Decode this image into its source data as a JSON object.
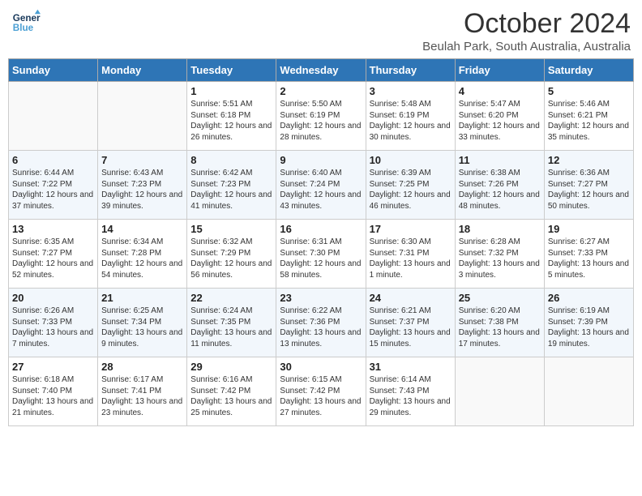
{
  "header": {
    "logo_line1": "General",
    "logo_line2": "Blue",
    "month": "October 2024",
    "location": "Beulah Park, South Australia, Australia"
  },
  "weekdays": [
    "Sunday",
    "Monday",
    "Tuesday",
    "Wednesday",
    "Thursday",
    "Friday",
    "Saturday"
  ],
  "weeks": [
    [
      {
        "day": "",
        "content": ""
      },
      {
        "day": "",
        "content": ""
      },
      {
        "day": "1",
        "content": "Sunrise: 5:51 AM\nSunset: 6:18 PM\nDaylight: 12 hours\nand 26 minutes."
      },
      {
        "day": "2",
        "content": "Sunrise: 5:50 AM\nSunset: 6:19 PM\nDaylight: 12 hours\nand 28 minutes."
      },
      {
        "day": "3",
        "content": "Sunrise: 5:48 AM\nSunset: 6:19 PM\nDaylight: 12 hours\nand 30 minutes."
      },
      {
        "day": "4",
        "content": "Sunrise: 5:47 AM\nSunset: 6:20 PM\nDaylight: 12 hours\nand 33 minutes."
      },
      {
        "day": "5",
        "content": "Sunrise: 5:46 AM\nSunset: 6:21 PM\nDaylight: 12 hours\nand 35 minutes."
      }
    ],
    [
      {
        "day": "6",
        "content": "Sunrise: 6:44 AM\nSunset: 7:22 PM\nDaylight: 12 hours\nand 37 minutes."
      },
      {
        "day": "7",
        "content": "Sunrise: 6:43 AM\nSunset: 7:23 PM\nDaylight: 12 hours\nand 39 minutes."
      },
      {
        "day": "8",
        "content": "Sunrise: 6:42 AM\nSunset: 7:23 PM\nDaylight: 12 hours\nand 41 minutes."
      },
      {
        "day": "9",
        "content": "Sunrise: 6:40 AM\nSunset: 7:24 PM\nDaylight: 12 hours\nand 43 minutes."
      },
      {
        "day": "10",
        "content": "Sunrise: 6:39 AM\nSunset: 7:25 PM\nDaylight: 12 hours\nand 46 minutes."
      },
      {
        "day": "11",
        "content": "Sunrise: 6:38 AM\nSunset: 7:26 PM\nDaylight: 12 hours\nand 48 minutes."
      },
      {
        "day": "12",
        "content": "Sunrise: 6:36 AM\nSunset: 7:27 PM\nDaylight: 12 hours\nand 50 minutes."
      }
    ],
    [
      {
        "day": "13",
        "content": "Sunrise: 6:35 AM\nSunset: 7:27 PM\nDaylight: 12 hours\nand 52 minutes."
      },
      {
        "day": "14",
        "content": "Sunrise: 6:34 AM\nSunset: 7:28 PM\nDaylight: 12 hours\nand 54 minutes."
      },
      {
        "day": "15",
        "content": "Sunrise: 6:32 AM\nSunset: 7:29 PM\nDaylight: 12 hours\nand 56 minutes."
      },
      {
        "day": "16",
        "content": "Sunrise: 6:31 AM\nSunset: 7:30 PM\nDaylight: 12 hours\nand 58 minutes."
      },
      {
        "day": "17",
        "content": "Sunrise: 6:30 AM\nSunset: 7:31 PM\nDaylight: 13 hours\nand 1 minute."
      },
      {
        "day": "18",
        "content": "Sunrise: 6:28 AM\nSunset: 7:32 PM\nDaylight: 13 hours\nand 3 minutes."
      },
      {
        "day": "19",
        "content": "Sunrise: 6:27 AM\nSunset: 7:33 PM\nDaylight: 13 hours\nand 5 minutes."
      }
    ],
    [
      {
        "day": "20",
        "content": "Sunrise: 6:26 AM\nSunset: 7:33 PM\nDaylight: 13 hours\nand 7 minutes."
      },
      {
        "day": "21",
        "content": "Sunrise: 6:25 AM\nSunset: 7:34 PM\nDaylight: 13 hours\nand 9 minutes."
      },
      {
        "day": "22",
        "content": "Sunrise: 6:24 AM\nSunset: 7:35 PM\nDaylight: 13 hours\nand 11 minutes."
      },
      {
        "day": "23",
        "content": "Sunrise: 6:22 AM\nSunset: 7:36 PM\nDaylight: 13 hours\nand 13 minutes."
      },
      {
        "day": "24",
        "content": "Sunrise: 6:21 AM\nSunset: 7:37 PM\nDaylight: 13 hours\nand 15 minutes."
      },
      {
        "day": "25",
        "content": "Sunrise: 6:20 AM\nSunset: 7:38 PM\nDaylight: 13 hours\nand 17 minutes."
      },
      {
        "day": "26",
        "content": "Sunrise: 6:19 AM\nSunset: 7:39 PM\nDaylight: 13 hours\nand 19 minutes."
      }
    ],
    [
      {
        "day": "27",
        "content": "Sunrise: 6:18 AM\nSunset: 7:40 PM\nDaylight: 13 hours\nand 21 minutes."
      },
      {
        "day": "28",
        "content": "Sunrise: 6:17 AM\nSunset: 7:41 PM\nDaylight: 13 hours\nand 23 minutes."
      },
      {
        "day": "29",
        "content": "Sunrise: 6:16 AM\nSunset: 7:42 PM\nDaylight: 13 hours\nand 25 minutes."
      },
      {
        "day": "30",
        "content": "Sunrise: 6:15 AM\nSunset: 7:42 PM\nDaylight: 13 hours\nand 27 minutes."
      },
      {
        "day": "31",
        "content": "Sunrise: 6:14 AM\nSunset: 7:43 PM\nDaylight: 13 hours\nand 29 minutes."
      },
      {
        "day": "",
        "content": ""
      },
      {
        "day": "",
        "content": ""
      }
    ]
  ]
}
